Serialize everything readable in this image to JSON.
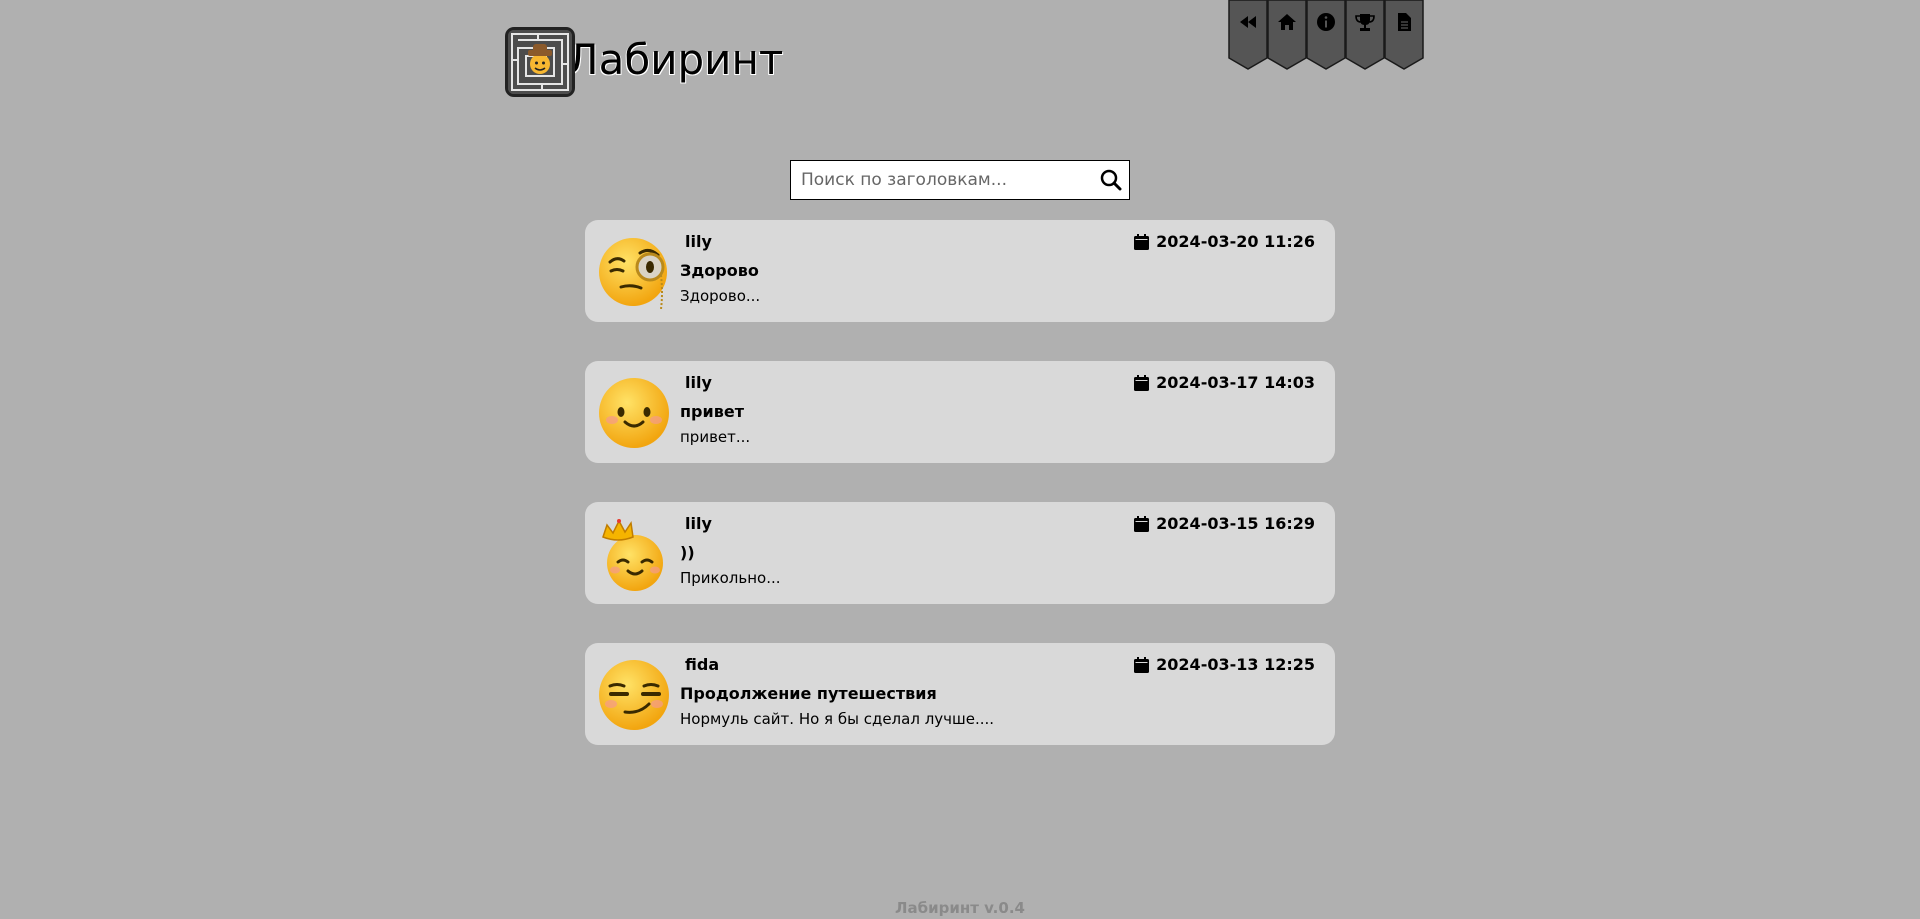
{
  "app": {
    "title": "Лабиринт",
    "logo_icon": "maze-cowboy-logo"
  },
  "nav": [
    {
      "icon": "backward-icon",
      "name": "nav-back"
    },
    {
      "icon": "home-icon",
      "name": "nav-home"
    },
    {
      "icon": "info-icon",
      "name": "nav-info"
    },
    {
      "icon": "trophy-icon",
      "name": "nav-trophy"
    },
    {
      "icon": "document-icon",
      "name": "nav-document"
    }
  ],
  "search": {
    "placeholder": "Поиск по заголовкам...",
    "value": ""
  },
  "posts": [
    {
      "author": "lily",
      "date": "2024-03-20 11:26",
      "title": "Здорово",
      "excerpt": "Здорово...",
      "avatar": "monocle-face-icon"
    },
    {
      "author": "lily",
      "date": "2024-03-17 14:03",
      "title": "привет",
      "excerpt": "привет...",
      "avatar": "smiling-face-icon"
    },
    {
      "author": "lily",
      "date": "2024-03-15 16:29",
      "title": "))",
      "excerpt": "Прикольно...",
      "avatar": "crowned-face-icon"
    },
    {
      "author": "fida",
      "date": "2024-03-13 12:25",
      "title": "Продолжение путешествия",
      "excerpt": "Нормуль сайт. Но я бы сделал лучше....",
      "avatar": "smirking-face-icon"
    }
  ],
  "footer": {
    "version": "Лабиринт v.0.4"
  },
  "colors": {
    "background": "#b0b0b0",
    "card": "#d9d9d9",
    "ribbon": "#555555",
    "footer_text": "#8a8a8a"
  }
}
